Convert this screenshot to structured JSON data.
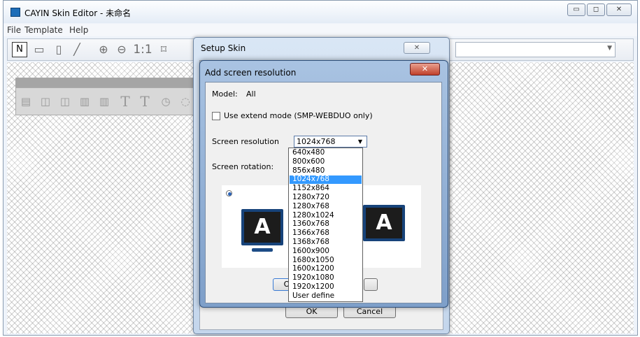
{
  "window": {
    "title": "CAYIN Skin Editor - 未命名",
    "minimize_icon": "▭",
    "maximize_icon": "◻",
    "close_icon": "✕"
  },
  "menu": [
    {
      "label": "File"
    },
    {
      "label": "Template"
    },
    {
      "label": "Help"
    }
  ],
  "toolbar": {
    "new_label": "N",
    "zoom_actual_label": "1:1"
  },
  "left_panel": {
    "text_tool_1": "T",
    "text_tool_2": "T"
  },
  "setup_skin": {
    "title": "Setup Skin",
    "close_icon": "✕",
    "ok_label": "OK",
    "cancel_label": "Cancel"
  },
  "add_resolution": {
    "title": "Add screen resolution",
    "close_icon": "✕",
    "model_label": "Model:",
    "model_value": "All",
    "extend_label": "Use extend mode (SMP-WEBDUO only)",
    "extend_checked": false,
    "resolution_label": "Screen resolution",
    "resolution_value": "1024x768",
    "rotation_label": "Screen rotation:",
    "monitor_letter_left": "A",
    "monitor_letter_right": "A",
    "ok_label": "O"
  },
  "resolution_options": [
    {
      "label": "640x480",
      "selected": false
    },
    {
      "label": "800x600",
      "selected": false
    },
    {
      "label": "856x480",
      "selected": false
    },
    {
      "label": "1024x768",
      "selected": true
    },
    {
      "label": "1152x864",
      "selected": false
    },
    {
      "label": "1280x720",
      "selected": false
    },
    {
      "label": "1280x768",
      "selected": false
    },
    {
      "label": "1280x1024",
      "selected": false
    },
    {
      "label": "1360x768",
      "selected": false
    },
    {
      "label": "1366x768",
      "selected": false
    },
    {
      "label": "1368x768",
      "selected": false
    },
    {
      "label": "1600x900",
      "selected": false
    },
    {
      "label": "1680x1050",
      "selected": false
    },
    {
      "label": "1600x1200",
      "selected": false
    },
    {
      "label": "1920x1080",
      "selected": false
    },
    {
      "label": "1920x1200",
      "selected": false
    },
    {
      "label": "User define",
      "selected": false
    }
  ],
  "colors": {
    "selection": "#3399ff",
    "monitor_frame": "#17437a",
    "dialog_frame": "#7e9fc9"
  }
}
